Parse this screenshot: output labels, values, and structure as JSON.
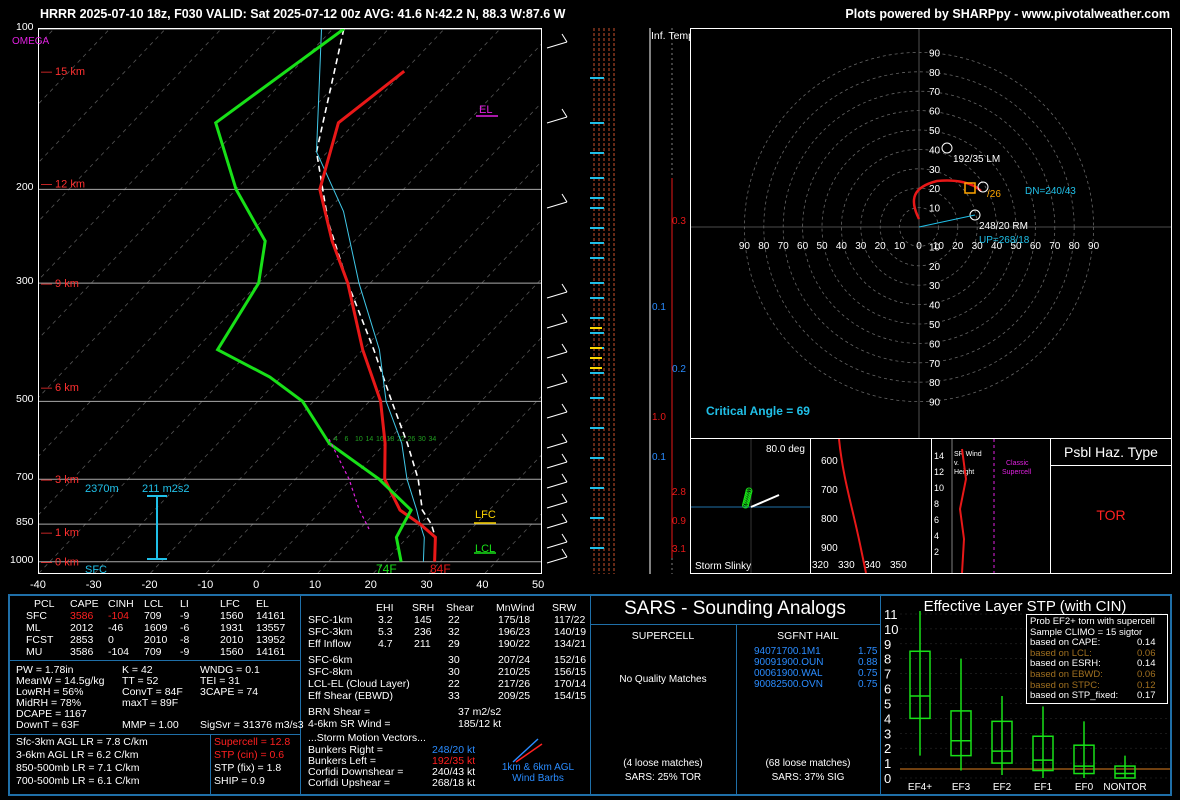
{
  "header": {
    "left": "HRRR 2025-07-10 18z, F030  VALID: Sat 2025-07-12 00z  AVG: 41.6 N:42.2 N, 88.3 W:87.6 W",
    "right": "Plots powered by SHARPpy - www.pivotalweather.com"
  },
  "colors": {
    "temp": "#e81818",
    "dewpoint": "#18e018",
    "parcel": "#ffffff",
    "virtual": "#40c8e8",
    "wetbulb": "#40c8e8",
    "omega": "#ff00ff",
    "highlight": "#ffd600",
    "frame": "#1f6fa8"
  },
  "skewt": {
    "omega_label": "OMEGA",
    "pressure_levels": [
      100,
      200,
      300,
      500,
      700,
      850,
      1000
    ],
    "temp_ticks": [
      -40,
      -30,
      -20,
      -10,
      0,
      10,
      20,
      30,
      40,
      50
    ],
    "height_labels": [
      "15 km",
      "12 km",
      "9 km",
      "6 km",
      "3 km",
      "1 km",
      "0 km"
    ],
    "sfc_label": "SFC",
    "el_label": "EL",
    "lfc_label": "LFC",
    "lcl_label": "LCL",
    "sfc_temp": "84F",
    "sfc_dew": "74F",
    "eff_inflow_base": "2370m",
    "eff_inflow_srh": "211 m2s2",
    "mixing_ratios": [
      "4",
      "6",
      "10",
      "14",
      "16",
      "18",
      "22",
      "26",
      "30",
      "34"
    ],
    "temp_profile": [
      [
        -60,
        120
      ],
      [
        -63,
        150
      ],
      [
        -55,
        200
      ],
      [
        -44,
        250
      ],
      [
        -34,
        300
      ],
      [
        -20,
        400
      ],
      [
        -8,
        500
      ],
      [
        0,
        600
      ],
      [
        6,
        700
      ],
      [
        14,
        800
      ],
      [
        20,
        850
      ],
      [
        25,
        900
      ],
      [
        29,
        1000
      ]
    ],
    "dew_profile": [
      [
        -78,
        100
      ],
      [
        -85,
        150
      ],
      [
        -70,
        200
      ],
      [
        -56,
        250
      ],
      [
        -50,
        300
      ],
      [
        -46,
        400
      ],
      [
        -32,
        450
      ],
      [
        -22,
        500
      ],
      [
        -10,
        600
      ],
      [
        5,
        700
      ],
      [
        16,
        800
      ],
      [
        17,
        850
      ],
      [
        18,
        900
      ],
      [
        23,
        1000
      ]
    ],
    "parcel_profile": [
      [
        -80,
        100
      ],
      [
        -60,
        170
      ],
      [
        -45,
        220
      ],
      [
        -30,
        300
      ],
      [
        -15,
        400
      ],
      [
        -5,
        500
      ],
      [
        5,
        600
      ],
      [
        12,
        700
      ],
      [
        19,
        800
      ],
      [
        22,
        850
      ],
      [
        25,
        900
      ],
      [
        29,
        1000
      ]
    ]
  },
  "inflow_panel": {
    "title": "Inf. Temp.",
    "labels": [
      "0.3",
      "0.1",
      "0.2",
      "1.0",
      "0.1",
      "2.8",
      "0.9",
      "3.1"
    ]
  },
  "hodograph": {
    "rings": [
      "10",
      "20",
      "30",
      "40",
      "50",
      "60",
      "70",
      "80",
      "90"
    ],
    "lm_label": "192/35 LM",
    "rm_label": "248/20 RM",
    "dn_label": "DN=240/43",
    "up_label": "UP=268/18",
    "mean_label": "/26",
    "critical_angle": "Critical Angle = 69"
  },
  "slinky": {
    "title": "80.0 deg",
    "label": "Storm Slinky"
  },
  "theta_panel": {
    "x_ticks": [
      "320",
      "330",
      "340",
      "350"
    ],
    "y_ticks": [
      "600",
      "700",
      "800",
      "900"
    ]
  },
  "wind_panel": {
    "label": "SR Wind v. Height",
    "y_ticks": [
      "14",
      "12",
      "10",
      "8",
      "6",
      "4",
      "2"
    ],
    "classic": "Classic Supercell"
  },
  "psbl_haz": {
    "title": "Psbl Haz. Type",
    "value": "TOR"
  },
  "parcels": {
    "headers": [
      "PCL",
      "CAPE",
      "CINH",
      "LCL",
      "LI",
      "LFC",
      "EL"
    ],
    "rows": [
      [
        "SFC",
        "3586",
        "-104",
        "709",
        "-9",
        "1560",
        "14161"
      ],
      [
        "ML",
        "2012",
        "-46",
        "1609",
        "-6",
        "1931",
        "13557"
      ],
      [
        "FCST",
        "2853",
        "0",
        "2010",
        "-8",
        "2010",
        "13952"
      ],
      [
        "MU",
        "3586",
        "-104",
        "709",
        "-9",
        "1560",
        "14161"
      ]
    ]
  },
  "indices": {
    "col1": [
      "PW = 1.78in",
      "MeanW = 14.5g/kg",
      "LowRH = 56%",
      "MidRH = 78%",
      "DCAPE = 1167",
      "DownT = 63F"
    ],
    "col2": [
      "K = 42",
      "TT = 52",
      "ConvT = 84F",
      "maxT = 89F",
      "",
      "MMP = 1.00"
    ],
    "col3": [
      "WNDG = 0.1",
      "TEI = 31",
      "3CAPE = 74",
      "",
      "",
      "SigSvr = 31376 m3/s3"
    ]
  },
  "lapse": [
    "Sfc-3km AGL LR = 7.8 C/km",
    "3-6km AGL LR = 6.2 C/km",
    "850-500mb LR = 7.1 C/km",
    "700-500mb LR = 6.1 C/km"
  ],
  "composites": {
    "supercell": "Supercell = 12.8",
    "stp_cin": "STP (cin) = 0.6",
    "stp_fix": "STP (fix) = 1.8",
    "ship": "SHIP = 0.9"
  },
  "kinematics": {
    "headers": [
      "EHI",
      "SRH",
      "Shear",
      "MnWind",
      "SRW"
    ],
    "rows": [
      [
        "SFC-1km",
        "3.2",
        "145",
        "22",
        "175/18",
        "117/22"
      ],
      [
        "SFC-3km",
        "5.3",
        "236",
        "32",
        "196/23",
        "140/19"
      ],
      [
        "Eff Inflow",
        "4.7",
        "211",
        "29",
        "190/22",
        "134/21"
      ],
      [
        "SFC-6km",
        "",
        "",
        "30",
        "207/24",
        "152/16"
      ],
      [
        "SFC-8km",
        "",
        "",
        "30",
        "210/25",
        "156/15"
      ],
      [
        "LCL-EL (Cloud Layer)",
        "",
        "",
        "22",
        "217/26",
        "170/14"
      ],
      [
        "Eff Shear (EBWD)",
        "",
        "",
        "33",
        "209/25",
        "154/15"
      ]
    ],
    "brn_label": "BRN Shear =",
    "brn_value": "37 m2/s2",
    "sr_label": "4-6km SR Wind =",
    "sr_value": "185/12 kt",
    "storm_motion": "...Storm Motion Vectors...",
    "motions": [
      [
        "Bunkers Right =",
        "248/20 kt"
      ],
      [
        "Bunkers Left =",
        "192/35 kt"
      ],
      [
        "Corfidi Downshear =",
        "240/43 kt"
      ],
      [
        "Corfidi Upshear =",
        "268/18 kt"
      ]
    ],
    "barbs_label": "1km & 6km AGL Wind Barbs"
  },
  "sars": {
    "title": "SARS - Sounding Analogs",
    "supercell_title": "SUPERCELL",
    "hail_title": "SGFNT HAIL",
    "supercell_text": "No Quality Matches",
    "hail_matches": [
      [
        "94071700.1M1",
        "1.75"
      ],
      [
        "90091900.OUN",
        "0.88"
      ],
      [
        "00061900.WAL",
        "0.75"
      ],
      [
        "90082500.OVN",
        "0.75"
      ]
    ],
    "supercell_loose": "(4 loose matches)",
    "supercell_pct": "SARS: 25% TOR",
    "hail_loose": "(68 loose matches)",
    "hail_pct": "SARS: 37% SIG"
  },
  "stp": {
    "title": "Effective Layer STP (with CIN)",
    "legend": [
      [
        "Prob EF2+ torn with supercell",
        ""
      ],
      [
        "Sample CLIMO = 15 sigtor",
        ""
      ],
      [
        "based on CAPE:",
        "0.14"
      ],
      [
        "based on LCL:",
        "0.06"
      ],
      [
        "based on ESRH:",
        "0.14"
      ],
      [
        "based on EBWD:",
        "0.06"
      ],
      [
        "based on STPC:",
        "0.12"
      ],
      [
        "based on STP_fixed:",
        "0.17"
      ]
    ],
    "y_ticks": [
      "0",
      "1",
      "2",
      "3",
      "4",
      "5",
      "6",
      "7",
      "8",
      "9",
      "10",
      "11"
    ]
  },
  "chart_data": [
    {
      "type": "line",
      "title": "Skew-T",
      "xlabel": "",
      "ylabel": "",
      "ylim": [
        1000,
        100
      ],
      "xlim": [
        -40,
        50
      ],
      "series": [
        {
          "name": "",
          "x": [
            -60,
            -63,
            -55,
            -44,
            -34,
            -20,
            -8,
            0,
            6,
            14,
            20,
            25,
            29
          ],
          "y": [
            120,
            150,
            200,
            250,
            300,
            400,
            500,
            600,
            700,
            800,
            850,
            900,
            1000
          ]
        },
        {
          "name": "",
          "x": [
            -78,
            -85,
            -70,
            -56,
            -50,
            -46,
            -32,
            -22,
            -10,
            5,
            16,
            17,
            18,
            23
          ],
          "y": [
            100,
            150,
            200,
            250,
            300,
            400,
            450,
            500,
            600,
            700,
            800,
            850,
            900,
            1000
          ]
        }
      ]
    },
    {
      "type": "box",
      "title": "Effective Layer STP (with CIN)",
      "categories": [
        "EF4+",
        "EF3",
        "EF2",
        "EF1",
        "EF0",
        "NONTOR"
      ],
      "boxes": [
        {
          "low": 1.5,
          "q1": 4.0,
          "median": 5.5,
          "q3": 8.5,
          "high": 11.2
        },
        {
          "low": 0.5,
          "q1": 1.5,
          "median": 2.5,
          "q3": 4.5,
          "high": 8.0
        },
        {
          "low": 0.2,
          "q1": 1.0,
          "median": 1.8,
          "q3": 3.8,
          "high": 5.5
        },
        {
          "low": 0.0,
          "q1": 0.5,
          "median": 1.2,
          "q3": 2.8,
          "high": 4.8
        },
        {
          "low": 0.0,
          "q1": 0.3,
          "median": 0.8,
          "q3": 2.2,
          "high": 3.8
        },
        {
          "low": 0.0,
          "q1": 0.0,
          "median": 0.3,
          "q3": 0.8,
          "high": 1.5
        }
      ],
      "ylim": [
        0,
        11
      ],
      "marker": 0.6
    }
  ]
}
